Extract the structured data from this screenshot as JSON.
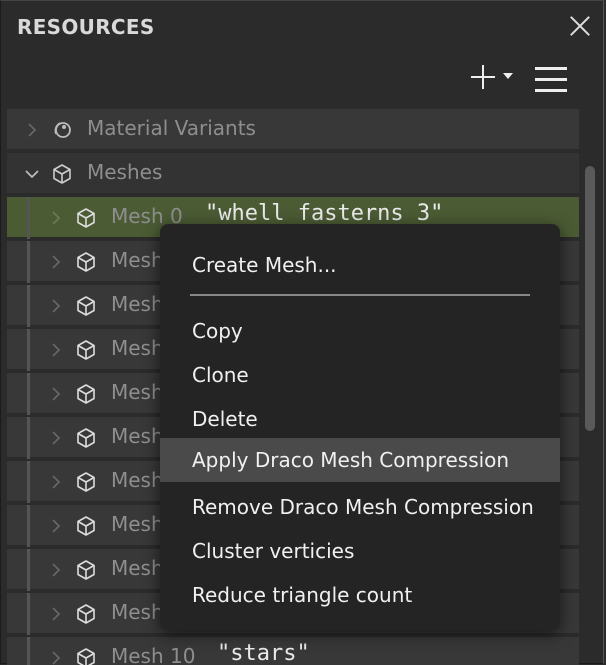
{
  "panel": {
    "title": "RESOURCES"
  },
  "toolbar": {
    "add_icon": "plus-icon",
    "menu_icon": "hamburger-icon"
  },
  "tree": {
    "material_variants": {
      "label": "Material Variants",
      "icon": "material-variants-icon"
    },
    "meshes": {
      "label": "Meshes",
      "icon": "cube-icon"
    },
    "mesh_rows": [
      {
        "label": "Mesh 0",
        "name": "\"whell fasterns 3\""
      },
      {
        "label": "Mesh",
        "name": ""
      },
      {
        "label": "Mesh",
        "name": ""
      },
      {
        "label": "Mesh",
        "name": ""
      },
      {
        "label": "Mesh",
        "name": ""
      },
      {
        "label": "Mesh",
        "name": ""
      },
      {
        "label": "Mesh",
        "name": ""
      },
      {
        "label": "Mesh",
        "name": ""
      },
      {
        "label": "Mesh",
        "name": ""
      },
      {
        "label": "Mesh",
        "name": ""
      },
      {
        "label": "Mesh 10",
        "name": "\"stars\""
      }
    ]
  },
  "context_menu": {
    "create": "Create Mesh...",
    "items": [
      "Copy",
      "Clone",
      "Delete",
      "Apply Draco Mesh Compression",
      "Remove Draco Mesh Compression",
      "Cluster verticies",
      "Reduce triangle count"
    ],
    "highlighted_index": 3
  },
  "colors": {
    "selected_row": "#4b5b34",
    "menu_bg": "#242424",
    "menu_highlight": "#4a4a4a"
  }
}
